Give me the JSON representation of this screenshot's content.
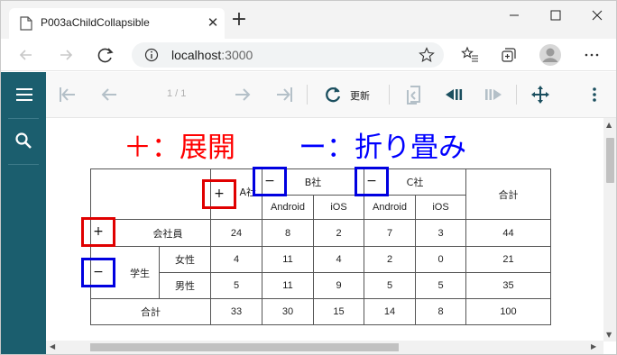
{
  "browser": {
    "tab_title": "P003aChildCollapsible",
    "tab_close_glyph": "✕",
    "new_tab_glyph": "+",
    "url_host": "localhost",
    "url_port": ":3000"
  },
  "viewer": {
    "page_indicator": "1 / 1",
    "refresh_label": "更新"
  },
  "legend": {
    "expand_text": "＋：展開",
    "collapse_text": "ー：折り畳み",
    "expand_color": "#ff0000",
    "collapse_color": "#0000ff"
  },
  "table": {
    "company_a": "A社",
    "company_b": "B社",
    "company_c": "C社",
    "total_header": "合計",
    "android": "Android",
    "ios": "iOS",
    "rows": [
      {
        "group": "会社員",
        "sub": "",
        "values": [
          "24",
          "8",
          "2",
          "7",
          "3",
          "44"
        ]
      },
      {
        "group": "学生",
        "sub": "女性",
        "values": [
          "4",
          "11",
          "4",
          "2",
          "0",
          "21"
        ]
      },
      {
        "group": "学生",
        "sub": "男性",
        "values": [
          "5",
          "11",
          "9",
          "5",
          "5",
          "35"
        ]
      }
    ],
    "total_label": "合計",
    "total_values": [
      "33",
      "30",
      "15",
      "14",
      "8",
      "100"
    ],
    "toggles": {
      "company_a": "+",
      "company_b": "−",
      "company_c": "−",
      "employee": "+",
      "student": "−"
    }
  },
  "icons": [
    "tab-favicon-icon",
    "back-icon",
    "forward-icon",
    "reload-icon",
    "info-icon",
    "favorite-star-icon",
    "favorites-icon",
    "collections-icon",
    "profile-icon",
    "more-icon",
    "hamburger-menu-icon",
    "search-icon",
    "first-page-icon",
    "prev-page-icon",
    "next-page-icon",
    "last-page-icon",
    "refresh-icon",
    "export-icon",
    "play-back-icon",
    "play-forward-icon",
    "move-icon",
    "kebab-menu-icon"
  ]
}
